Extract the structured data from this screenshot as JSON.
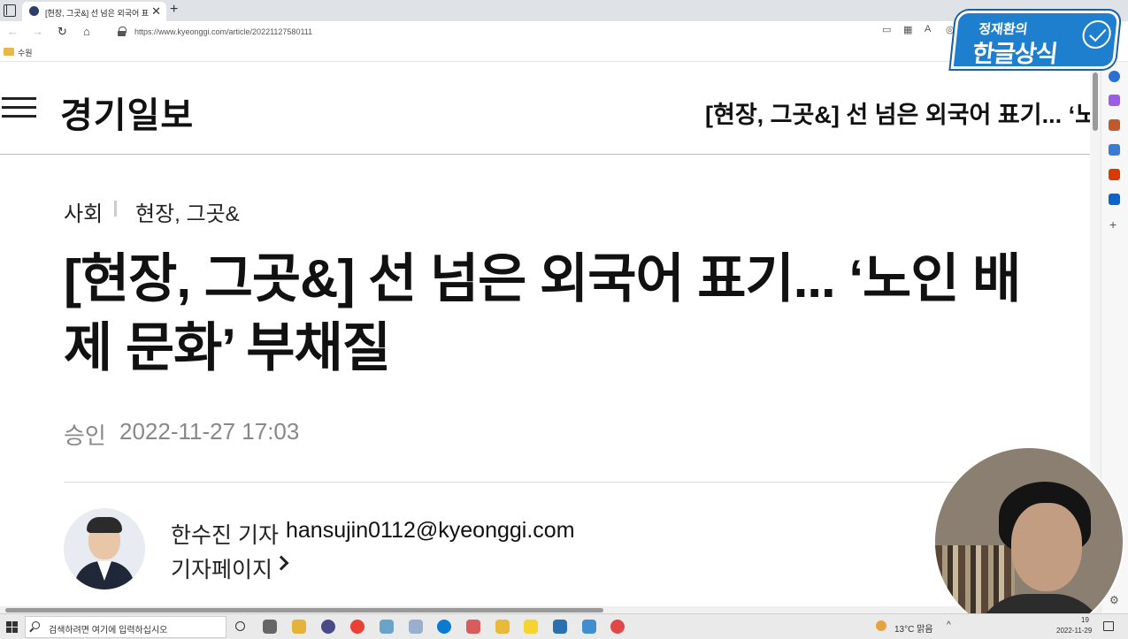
{
  "browser": {
    "tab_title": "[현장, 그곳&] 선 넘은 외국어 표",
    "tab_close": "✕",
    "new_tab": "+",
    "url": "https://www.kyeonggi.com/article/20221127580111",
    "favorites": [
      {
        "label": "수원"
      }
    ]
  },
  "site": {
    "logo": "경기일보",
    "header_title": "[현장, 그곳&] 선 넘은 외국어 표기... ‘노"
  },
  "article": {
    "category": "사회",
    "subcategory": "현장, 그곳&",
    "headline": "[현장, 그곳&] 선 넘은 외국어 표기... ‘노인 배제 문화’ 부채질",
    "approved_label": "승인",
    "approved_date": "2022-11-27 17:03",
    "reporter": {
      "name": "한수진 기자",
      "email": "hansujin0112@kyeonggi.com",
      "page_link": "기자페이지"
    }
  },
  "overlay": {
    "badge_top": "정재환의",
    "badge_main": "한글상식"
  },
  "taskbar": {
    "search_placeholder": "검색하려면 여기에 입력하십시오",
    "weather": "13°C 맑음",
    "date": "2022-11-29",
    "time": "19"
  },
  "colors": {
    "accent_badge": "#1f7fcf",
    "text_primary": "#111111",
    "text_meta": "#888888"
  }
}
